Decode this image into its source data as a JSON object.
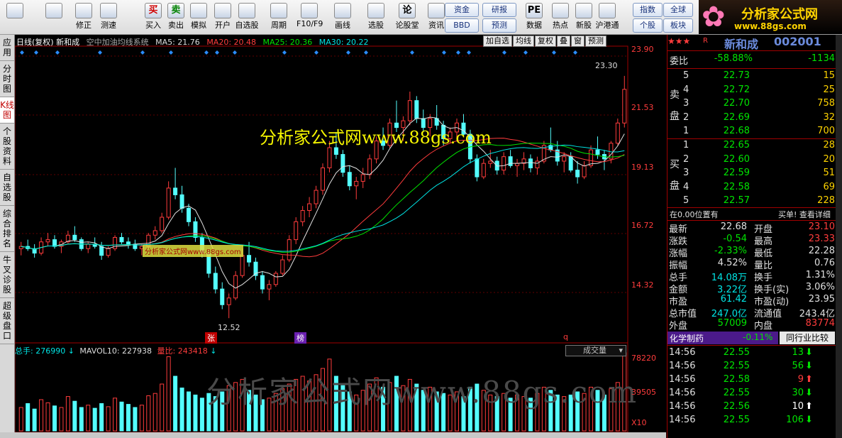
{
  "toolbar": {
    "buttons": [
      {
        "label": "",
        "icon": "windows-icon"
      },
      {
        "label": "",
        "icon": "back-arrow-icon"
      },
      {
        "label": "修正",
        "icon": "clock-icon"
      },
      {
        "label": "测速",
        "icon": "stopwatch-icon"
      },
      {
        "label": "买入",
        "icon": "buy-icon",
        "glyph": "买"
      },
      {
        "label": "卖出",
        "icon": "sell-icon",
        "glyph": "卖"
      },
      {
        "label": "模拟",
        "icon": "hammer-icon"
      },
      {
        "label": "开户",
        "icon": "lock-icon"
      },
      {
        "label": "自选股",
        "icon": "star-icon"
      },
      {
        "label": "周期",
        "icon": "clock-cycle-icon"
      },
      {
        "label": "F10/F9",
        "icon": "f10-icon"
      },
      {
        "label": "画线",
        "icon": "pen-icon"
      },
      {
        "label": "选股",
        "icon": "filter-icon"
      },
      {
        "label": "论股堂",
        "icon": "forum-icon",
        "glyph": "论"
      },
      {
        "label": "资讯",
        "icon": "news-icon"
      },
      {
        "label": "数据",
        "icon": "pe-icon",
        "glyph": "PE"
      },
      {
        "label": "热点",
        "icon": "hot-icon"
      },
      {
        "label": "新股",
        "icon": "ipo-icon"
      },
      {
        "label": "沪港通",
        "icon": "sse-hk-icon"
      }
    ],
    "pill_buttons": [
      "资金",
      "BBD",
      "研报",
      "预测",
      "指数",
      "全球",
      "个股",
      "板块"
    ]
  },
  "logo": {
    "title": "分析家公式网",
    "url": "www.88gs.com"
  },
  "left_tabs": [
    "应用",
    "分时图",
    "K线图",
    "个股资料",
    "自选股",
    "综合排名",
    "牛叉诊股",
    "超级盘口"
  ],
  "chart": {
    "header": {
      "title": "日线(复权) 新和成",
      "system": "空中加油均线系统",
      "ma5": "MA5: 21.76",
      "ma20": "MA20: 20.48",
      "ma25": "MA25: 20.36",
      "ma30": "MA30: 20.22"
    },
    "buttons": [
      "加自选",
      "均线",
      "复权",
      "叠",
      "窗",
      "预测"
    ],
    "y_labels": [
      "23.90",
      "21.53",
      "19.13",
      "16.72",
      "14.32"
    ],
    "price_high": "23.30",
    "price_low": "12.52",
    "markers": [
      "张",
      "榜",
      "q"
    ],
    "watermark_main": "分析家公式网www.88gs.com",
    "watermark_small": "分析家公式网www.88gs.com",
    "watermark_bottom": "分析家公式网www.88gs.com",
    "volume_header": {
      "total": "总手: 276990",
      "mavol": "MAVOL10: 227938",
      "ratio": "量比: 243418"
    },
    "volume_select": "成交量",
    "volume_labels": [
      "78220",
      "39505",
      "X10"
    ]
  },
  "chart_data": {
    "type": "candlestick",
    "ylim": [
      12.0,
      24.5
    ],
    "candles": [
      [
        15.6,
        15.9,
        15.3,
        15.7
      ],
      [
        15.7,
        16.0,
        15.5,
        15.6
      ],
      [
        15.6,
        15.8,
        15.2,
        15.4
      ],
      [
        15.4,
        16.1,
        15.3,
        15.9
      ],
      [
        15.9,
        16.3,
        15.7,
        16.0
      ],
      [
        16.0,
        16.2,
        15.6,
        15.7
      ],
      [
        15.7,
        16.0,
        15.4,
        15.9
      ],
      [
        15.9,
        16.4,
        15.8,
        16.2
      ],
      [
        16.2,
        16.6,
        15.9,
        16.0
      ],
      [
        16.0,
        16.1,
        15.5,
        15.6
      ],
      [
        15.6,
        15.9,
        15.4,
        15.8
      ],
      [
        15.8,
        16.1,
        15.6,
        15.7
      ],
      [
        15.7,
        15.9,
        15.1,
        15.3
      ],
      [
        15.3,
        15.7,
        15.2,
        15.6
      ],
      [
        15.6,
        16.2,
        15.5,
        16.1
      ],
      [
        16.1,
        16.3,
        15.8,
        15.9
      ],
      [
        15.9,
        16.1,
        15.6,
        15.8
      ],
      [
        15.8,
        16.0,
        15.5,
        15.6
      ],
      [
        15.6,
        15.8,
        15.3,
        15.7
      ],
      [
        15.7,
        16.3,
        15.6,
        16.2
      ],
      [
        16.2,
        16.6,
        16.0,
        16.4
      ],
      [
        16.4,
        17.2,
        16.3,
        17.0
      ],
      [
        17.0,
        18.6,
        16.9,
        18.3
      ],
      [
        18.3,
        19.2,
        17.8,
        18.0
      ],
      [
        18.0,
        18.4,
        17.2,
        17.4
      ],
      [
        17.4,
        17.6,
        16.6,
        16.8
      ],
      [
        16.8,
        17.0,
        15.9,
        16.1
      ],
      [
        16.1,
        16.3,
        15.2,
        15.4
      ],
      [
        15.4,
        15.6,
        14.3,
        14.5
      ],
      [
        14.5,
        14.8,
        13.6,
        13.8
      ],
      [
        13.8,
        14.1,
        12.9,
        13.1
      ],
      [
        13.1,
        13.6,
        12.5,
        13.4
      ],
      [
        13.4,
        14.6,
        13.3,
        14.4
      ],
      [
        14.4,
        15.6,
        14.3,
        15.3
      ],
      [
        15.3,
        15.9,
        14.8,
        15.0
      ],
      [
        15.0,
        15.2,
        14.2,
        14.4
      ],
      [
        14.4,
        14.6,
        13.6,
        13.8
      ],
      [
        13.8,
        14.2,
        13.3,
        14.0
      ],
      [
        14.0,
        14.6,
        13.9,
        14.5
      ],
      [
        14.5,
        15.3,
        14.4,
        15.1
      ],
      [
        15.1,
        16.2,
        15.0,
        16.0
      ],
      [
        16.0,
        17.0,
        15.8,
        16.8
      ],
      [
        16.8,
        17.5,
        16.6,
        17.3
      ],
      [
        17.3,
        17.9,
        17.0,
        17.6
      ],
      [
        17.6,
        18.4,
        17.4,
        18.2
      ],
      [
        18.2,
        19.4,
        18.0,
        19.2
      ],
      [
        19.2,
        20.4,
        19.0,
        20.1
      ],
      [
        20.1,
        20.8,
        19.6,
        19.8
      ],
      [
        19.8,
        20.0,
        18.8,
        19.0
      ],
      [
        19.0,
        19.3,
        18.2,
        18.4
      ],
      [
        18.4,
        18.8,
        17.8,
        18.6
      ],
      [
        18.6,
        19.2,
        18.3,
        18.9
      ],
      [
        18.9,
        19.8,
        18.7,
        19.6
      ],
      [
        19.6,
        20.6,
        19.4,
        20.4
      ],
      [
        20.4,
        21.0,
        20.0,
        20.2
      ],
      [
        20.2,
        21.4,
        20.1,
        21.2
      ],
      [
        21.2,
        22.2,
        20.8,
        21.0
      ],
      [
        21.0,
        21.5,
        20.4,
        21.3
      ],
      [
        21.3,
        22.6,
        21.1,
        22.2
      ],
      [
        22.2,
        22.4,
        21.2,
        21.4
      ],
      [
        21.4,
        21.8,
        20.8,
        21.0
      ],
      [
        21.0,
        21.6,
        20.6,
        21.4
      ],
      [
        21.4,
        22.0,
        20.9,
        21.1
      ],
      [
        21.1,
        21.3,
        20.2,
        20.5
      ],
      [
        20.5,
        21.0,
        20.3,
        20.8
      ],
      [
        20.8,
        21.4,
        20.5,
        21.2
      ],
      [
        21.2,
        21.6,
        20.6,
        20.7
      ],
      [
        20.7,
        20.9,
        19.4,
        19.6
      ],
      [
        19.6,
        19.8,
        18.6,
        18.8
      ],
      [
        18.8,
        19.6,
        18.7,
        19.4
      ],
      [
        19.4,
        20.0,
        19.2,
        19.5
      ],
      [
        19.5,
        19.7,
        18.9,
        19.1
      ],
      [
        19.1,
        19.9,
        18.9,
        19.7
      ],
      [
        19.7,
        20.0,
        19.2,
        19.3
      ],
      [
        19.3,
        19.6,
        18.8,
        19.4
      ],
      [
        19.4,
        19.9,
        19.1,
        19.6
      ],
      [
        19.6,
        19.8,
        19.0,
        19.2
      ],
      [
        19.2,
        19.7,
        18.9,
        19.5
      ],
      [
        19.5,
        20.4,
        19.4,
        20.2
      ],
      [
        20.2,
        21.0,
        19.9,
        20.0
      ],
      [
        20.0,
        20.4,
        19.3,
        19.5
      ],
      [
        19.5,
        19.9,
        19.0,
        19.7
      ],
      [
        19.7,
        19.9,
        19.0,
        19.1
      ],
      [
        19.1,
        19.5,
        18.5,
        18.8
      ],
      [
        18.8,
        19.5,
        18.7,
        19.3
      ],
      [
        19.3,
        20.2,
        19.2,
        20.0
      ],
      [
        20.0,
        20.6,
        19.6,
        19.8
      ],
      [
        19.8,
        20.0,
        19.1,
        19.6
      ],
      [
        19.6,
        20.4,
        19.4,
        20.3
      ],
      [
        20.3,
        21.4,
        20.2,
        21.2
      ],
      [
        21.2,
        23.3,
        21.0,
        22.7
      ]
    ],
    "volumes": [
      30,
      35,
      28,
      40,
      36,
      32,
      30,
      44,
      38,
      30,
      33,
      29,
      35,
      31,
      42,
      37,
      34,
      30,
      33,
      45,
      48,
      60,
      95,
      70,
      55,
      50,
      46,
      42,
      48,
      44,
      50,
      58,
      62,
      66,
      52,
      46,
      40,
      42,
      48,
      54,
      60,
      66,
      70,
      64,
      72,
      80,
      92,
      70,
      58,
      50,
      46,
      52,
      60,
      68,
      56,
      62,
      70,
      58,
      66,
      60,
      52,
      56,
      50,
      48,
      46,
      50,
      44,
      56,
      60,
      52,
      46,
      44,
      48,
      42,
      46,
      44,
      42,
      48,
      56,
      52,
      46,
      44,
      46,
      50,
      48,
      56,
      52,
      46,
      54,
      62,
      100
    ]
  },
  "quote": {
    "stock_name": "新和成",
    "stock_code": "002001",
    "stars": "★★★",
    "weibi": {
      "label": "委比",
      "value": "-58.88%",
      "diff": "-1134"
    },
    "sell_label": "卖盘",
    "buy_label": "买盘",
    "sell": [
      {
        "lvl": "5",
        "price": "22.73",
        "vol": "15"
      },
      {
        "lvl": "4",
        "price": "22.72",
        "vol": "25"
      },
      {
        "lvl": "3",
        "price": "22.70",
        "vol": "758"
      },
      {
        "lvl": "2",
        "price": "22.69",
        "vol": "32"
      },
      {
        "lvl": "1",
        "price": "22.68",
        "vol": "700"
      }
    ],
    "buy": [
      {
        "lvl": "1",
        "price": "22.65",
        "vol": "28"
      },
      {
        "lvl": "2",
        "price": "22.60",
        "vol": "20"
      },
      {
        "lvl": "3",
        "price": "22.59",
        "vol": "51"
      },
      {
        "lvl": "4",
        "price": "22.58",
        "vol": "69"
      },
      {
        "lvl": "5",
        "price": "22.57",
        "vol": "228"
      }
    ],
    "note_left": "在0.00位置有",
    "note_right": "买单! 查看详细",
    "stats": [
      {
        "l": "最新",
        "v": "22.68",
        "l2": "开盘",
        "v2": "23.10"
      },
      {
        "l": "涨跌",
        "v": "-0.54",
        "l2": "最高",
        "v2": "23.33"
      },
      {
        "l": "涨幅",
        "v": "-2.33%",
        "l2": "最低",
        "v2": "22.28"
      },
      {
        "l": "振幅",
        "v": "4.52%",
        "l2": "量比",
        "v2": "0.76"
      },
      {
        "l": "总手",
        "v": "14.08万",
        "l2": "换手",
        "v2": "1.31%"
      },
      {
        "l": "金额",
        "v": "3.22亿",
        "l2": "换手(实)",
        "v2": "3.06%"
      },
      {
        "l": "市盈",
        "v": "61.42",
        "l2": "市盈(动)",
        "v2": "23.95"
      },
      {
        "l": "总市值",
        "v": "247.0亿",
        "l2": "流通值",
        "v2": "243.4亿"
      },
      {
        "l": "外盘",
        "v": "57009",
        "l2": "内盘",
        "v2": "83774"
      }
    ],
    "industry": {
      "name": "化学制药",
      "change": "-0.11%",
      "compare": "同行业比较"
    },
    "ticks": [
      {
        "t": "14:56",
        "p": "22.55",
        "v": "13",
        "d": "down"
      },
      {
        "t": "14:56",
        "p": "22.55",
        "v": "56",
        "d": "down"
      },
      {
        "t": "14:56",
        "p": "22.58",
        "v": "9",
        "d": "up"
      },
      {
        "t": "14:56",
        "p": "22.55",
        "v": "30",
        "d": "down"
      },
      {
        "t": "14:56",
        "p": "22.56",
        "v": "10",
        "d": "up"
      },
      {
        "t": "14:56",
        "p": "22.55",
        "v": "106",
        "d": "down"
      }
    ]
  }
}
